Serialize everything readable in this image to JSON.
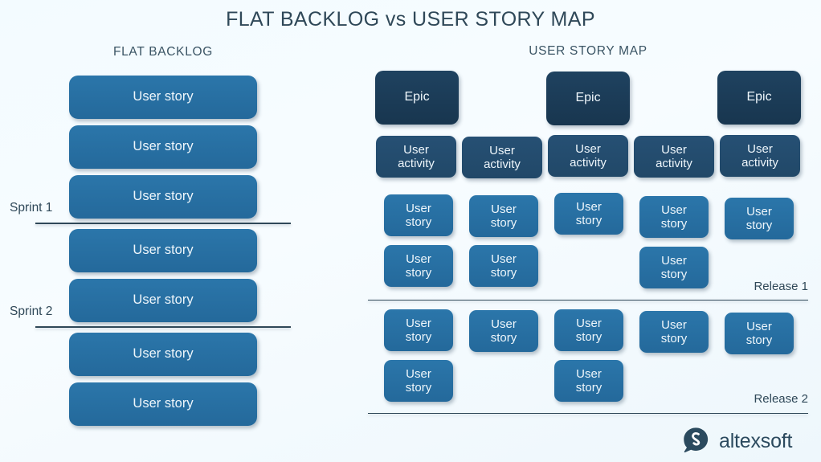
{
  "title": "FLAT BACKLOG vs USER STORY MAP",
  "colors": {
    "background": "#f4fbff",
    "title_text": "#2f4858",
    "card_blue": "#2872a4",
    "card_navy_dark": "#1b3a53",
    "card_navy_mid": "#24506f",
    "divider": "#2f4858",
    "logo": "#2b4a5e"
  },
  "flat_backlog": {
    "heading": "FLAT BACKLOG",
    "cards": [
      {
        "label": "User story"
      },
      {
        "label": "User story"
      },
      {
        "label": "User story"
      },
      {
        "label": "User story"
      },
      {
        "label": "User story"
      },
      {
        "label": "User story"
      },
      {
        "label": "User story"
      }
    ],
    "sprint_labels": [
      {
        "label": "Sprint 1"
      },
      {
        "label": "Sprint 2"
      }
    ]
  },
  "user_story_map": {
    "heading": "USER STORY MAP",
    "epics": [
      {
        "label": "Epic"
      },
      {
        "label": "Epic"
      },
      {
        "label": "Epic"
      }
    ],
    "activities": [
      {
        "label": "User\nactivity",
        "line1": "User",
        "line2": "activity"
      },
      {
        "label": "User\nactivity",
        "line1": "User",
        "line2": "activity"
      },
      {
        "label": "User\nactivity",
        "line1": "User",
        "line2": "activity"
      },
      {
        "label": "User\nactivity",
        "line1": "User",
        "line2": "activity"
      },
      {
        "label": "User\nactivity",
        "line1": "User",
        "line2": "activity"
      }
    ],
    "story_line1": "User",
    "story_line2": "story",
    "releases": [
      {
        "label": "Release 1",
        "rows": [
          [
            true,
            true,
            true,
            true,
            true
          ],
          [
            true,
            true,
            false,
            true,
            false
          ]
        ]
      },
      {
        "label": "Release 2",
        "rows": [
          [
            true,
            true,
            true,
            true,
            true
          ],
          [
            true,
            false,
            true,
            false,
            false
          ]
        ]
      }
    ]
  },
  "logo": {
    "wordmark": "altexsoft"
  }
}
